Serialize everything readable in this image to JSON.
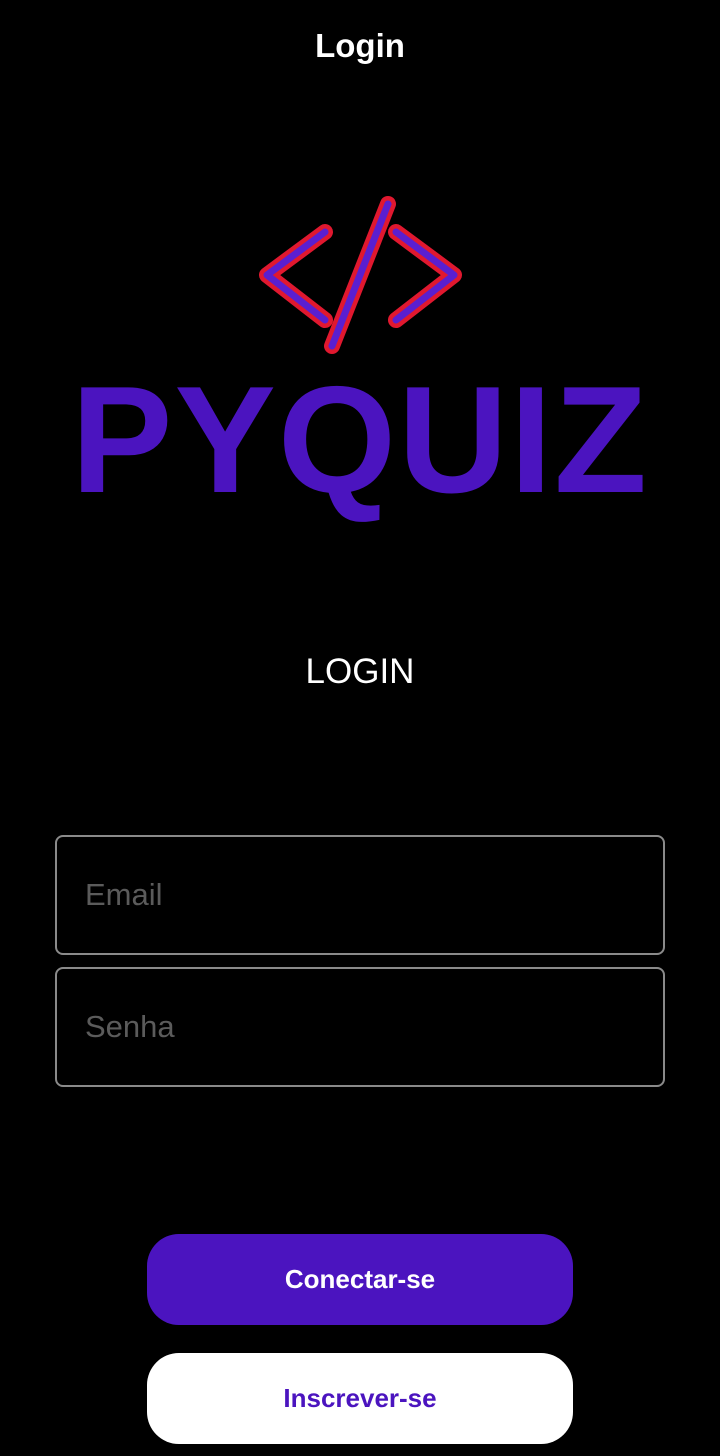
{
  "app_bar": {
    "title": "Login"
  },
  "logo": {
    "wordmark": "PYQUIZ",
    "icon": "code-brackets-icon",
    "colors": {
      "wordmark": "#4b14bf",
      "icon_glow": "#e0182f",
      "icon_fill": "#5a1fd0"
    }
  },
  "form": {
    "heading": "LOGIN",
    "email": {
      "value": "",
      "placeholder": "Email"
    },
    "password": {
      "value": "",
      "placeholder": "Senha"
    }
  },
  "actions": {
    "connect_label": "Conectar-se",
    "signup_label": "Inscrever-se"
  },
  "colors": {
    "background": "#000000",
    "accent": "#4b14bf",
    "field_border": "#8a8a8a",
    "placeholder": "#5b5b5b"
  }
}
